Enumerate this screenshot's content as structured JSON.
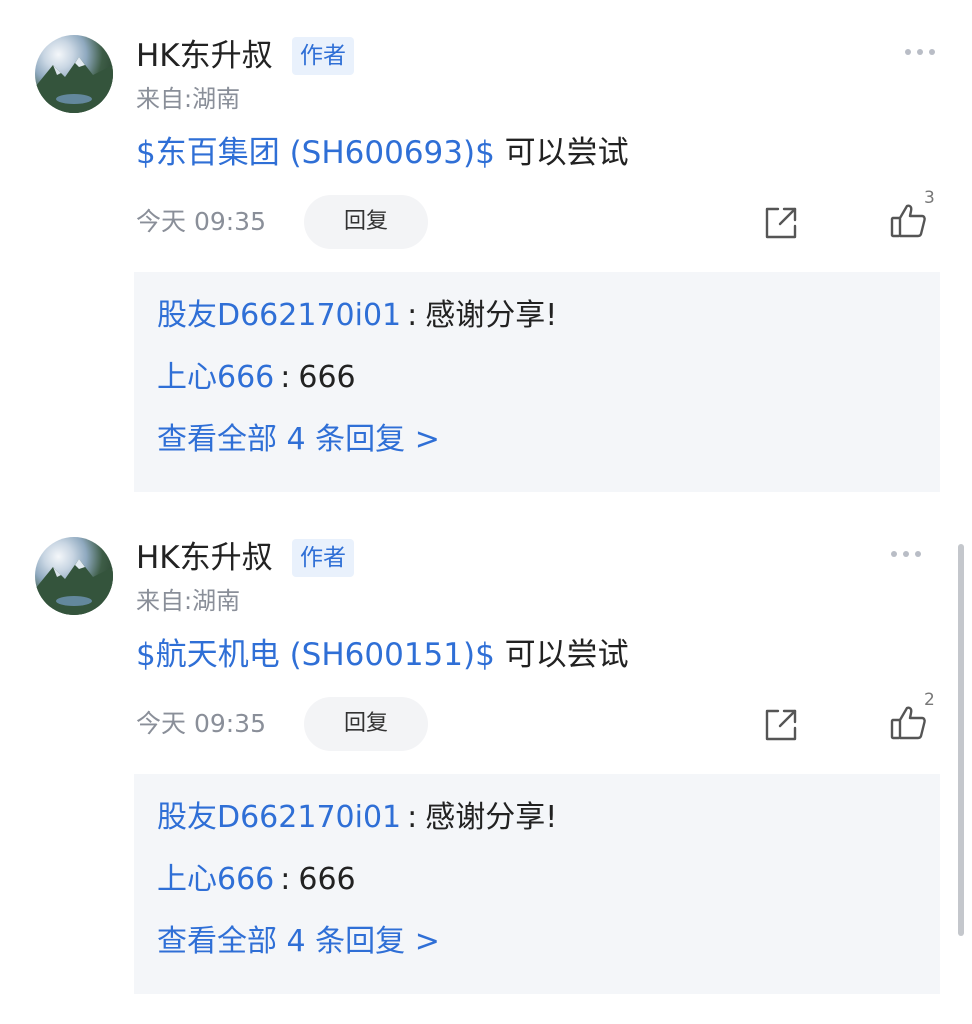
{
  "comments": [
    {
      "user_name": "HK东升叔",
      "badge": "作者",
      "location": "来自:湖南",
      "stock_tag": "$东百集团 (SH600693)$",
      "text": " 可以尝试",
      "time": "今天 09:35",
      "reply_label": "回复",
      "like_count": "3",
      "replies": [
        {
          "user": "股友D662170i01",
          "colon": ":",
          "text": "感谢分享!"
        },
        {
          "user": "上心666",
          "colon": ":",
          "text": "666"
        }
      ],
      "view_all": "查看全部 4 条回复 >"
    },
    {
      "user_name": "HK东升叔",
      "badge": "作者",
      "location": "来自:湖南",
      "stock_tag": "$航天机电 (SH600151)$",
      "text": " 可以尝试",
      "time": "今天 09:35",
      "reply_label": "回复",
      "like_count": "2",
      "replies": [
        {
          "user": "股友D662170i01",
          "colon": ":",
          "text": "感谢分享!"
        },
        {
          "user": "上心666",
          "colon": ":",
          "text": "666"
        }
      ],
      "view_all": "查看全部 4 条回复 >"
    }
  ],
  "icons": {
    "more": "more-dots-icon",
    "share": "share-icon",
    "like": "thumbs-up-icon"
  },
  "colors": {
    "accent": "#2f6fd6",
    "muted": "#8a8f99",
    "reply_bg": "#f4f6f9"
  }
}
